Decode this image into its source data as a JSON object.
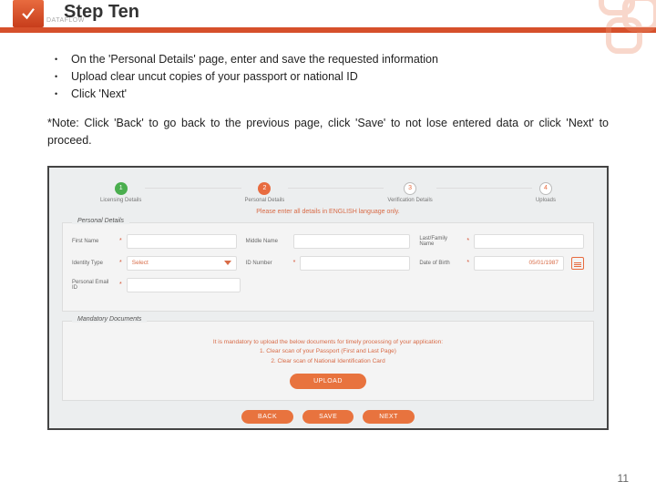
{
  "brand": "DATAFLOW",
  "title": "Step Ten",
  "bullets": [
    "On the 'Personal Details' page, enter and save the requested information",
    "Upload clear uncut copies of your passport or national ID",
    "Click 'Next'"
  ],
  "note": "*Note: Click 'Back' to go back to the previous page, click 'Save' to not lose entered data or click 'Next' to proceed.",
  "stepper": {
    "steps": [
      {
        "num": "1",
        "label": "Licensing Details"
      },
      {
        "num": "2",
        "label": "Personal Details"
      },
      {
        "num": "3",
        "label": "Verification Details"
      },
      {
        "num": "4",
        "label": "Uploads"
      }
    ]
  },
  "lang_note": "Please enter all details in ENGLISH language only.",
  "panels": {
    "personal": {
      "legend": "Personal Details",
      "fields": {
        "first_name": "First Name",
        "middle_name": "Middle Name",
        "last_name": "Last/Family Name",
        "identity_type": "Identity Type",
        "identity_select": "Select",
        "id_number": "ID Number",
        "dob": "Date of Birth",
        "dob_value": "05/01/1987",
        "email": "Personal Email ID"
      }
    },
    "mandatory": {
      "legend": "Mandatory Documents",
      "text_lines": [
        "It is mandatory to upload the below documents for timely processing of your application:",
        "1. Clear scan of your Passport (First and Last Page)",
        "2. Clear scan of National Identification Card"
      ],
      "upload": "UPLOAD"
    }
  },
  "buttons": {
    "back": "BACK",
    "save": "SAVE",
    "next": "NEXT"
  },
  "page_number": "11"
}
